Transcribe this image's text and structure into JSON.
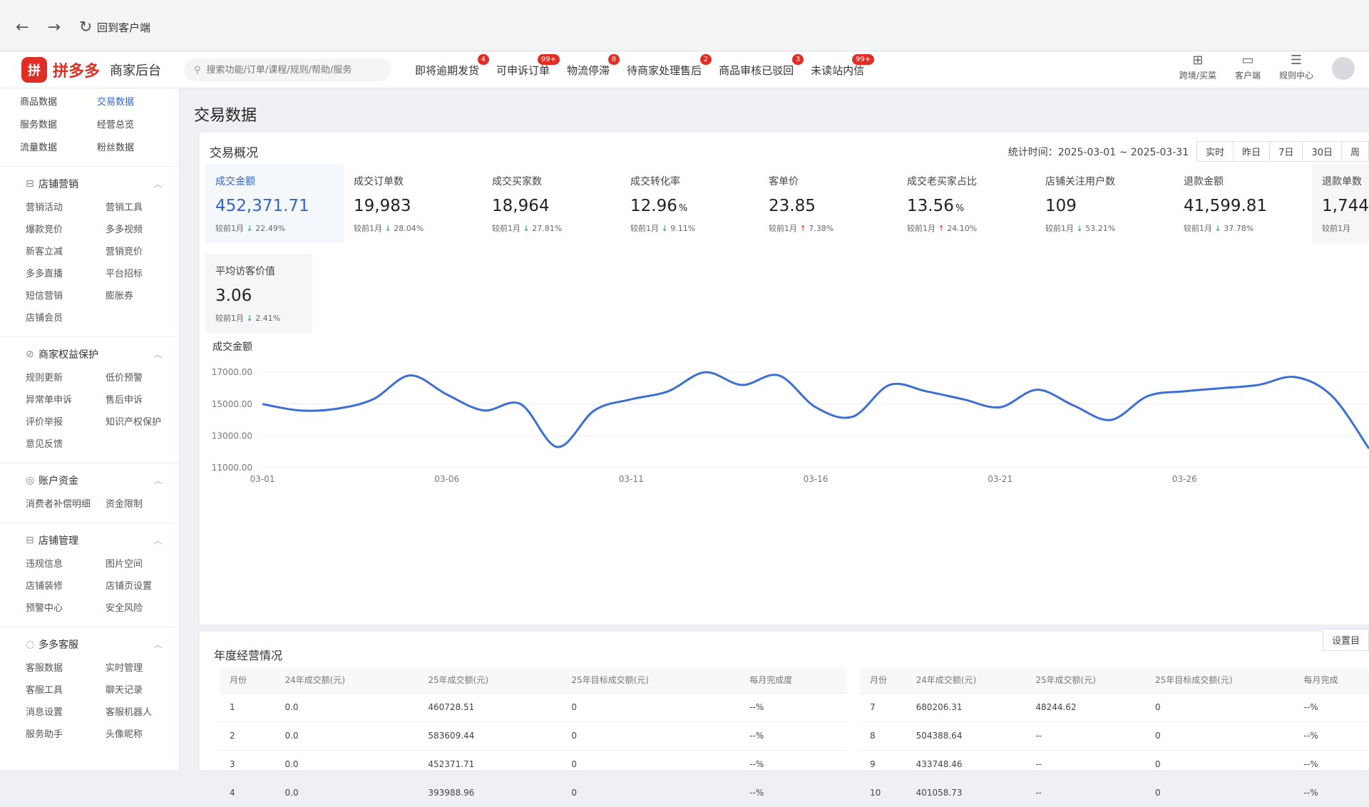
{
  "browser": {
    "back_link": "回到客户端"
  },
  "header": {
    "logo_mark": "拼",
    "logo_name": "拼多多",
    "logo_sub": "商家后台",
    "search_placeholder": "搜索功能/订单/课程/规则/帮助/服务",
    "links": [
      {
        "label": "即将逾期发货",
        "badge": "4"
      },
      {
        "label": "可申诉订单",
        "badge": "99+"
      },
      {
        "label": "物流停滞",
        "badge": "8"
      },
      {
        "label": "待商家处理售后",
        "badge": "2"
      },
      {
        "label": "商品审核已驳回",
        "badge": "3"
      },
      {
        "label": "未读站内信",
        "badge": "99+"
      }
    ],
    "icons": [
      {
        "label": "跨境/买菜",
        "icon": "globe-icon"
      },
      {
        "label": "客户端",
        "icon": "monitor-icon"
      },
      {
        "label": "规则中心",
        "icon": "rules-icon"
      }
    ]
  },
  "sidebar": {
    "quick": [
      "商品数据",
      "交易数据",
      "服务数据",
      "经营总览",
      "流量数据",
      "粉丝数据"
    ],
    "quick_active": "交易数据",
    "sections": [
      {
        "title": "店铺营销",
        "icon": "shop-icon",
        "items": [
          "营销活动",
          "营销工具",
          "爆款竞价",
          "多多视频",
          "新客立减",
          "营销竞价",
          "多多直播",
          "平台招标",
          "短信营销",
          "膨胀券",
          "店铺会员"
        ]
      },
      {
        "title": "商家权益保护",
        "icon": "shield-icon",
        "items": [
          "规则更新",
          "低价预警",
          "异常单申诉",
          "售后申诉",
          "评价举报",
          "知识产权保护",
          "意见反馈"
        ]
      },
      {
        "title": "账户资金",
        "icon": "wallet-icon",
        "items": [
          "消费者补偿明细",
          "资金限制"
        ]
      },
      {
        "title": "店铺管理",
        "icon": "store-icon",
        "items": [
          "违规信息",
          "图片空间",
          "店铺装修",
          "店铺页设置",
          "预警中心",
          "安全风险"
        ]
      },
      {
        "title": "多多客服",
        "icon": "headset-icon",
        "items": [
          "客服数据",
          "实时管理",
          "客服工具",
          "聊天记录",
          "消息设置",
          "客服机器人",
          "服务助手",
          "头像昵称"
        ]
      }
    ]
  },
  "main": {
    "page_title": "交易数据",
    "overview_title": "交易概况",
    "stat_time": "统计时间：2025-03-01 ~ 2025-03-31",
    "period_tabs": [
      "实时",
      "昨日",
      "7日",
      "30日",
      "周"
    ],
    "metrics": [
      {
        "label": "成交金额",
        "value": "452,371.71",
        "unit": "",
        "cmp_label": "较前1月",
        "dir": "down",
        "cmp": "22.49%"
      },
      {
        "label": "成交订单数",
        "value": "19,983",
        "unit": "",
        "cmp_label": "较前1月",
        "dir": "down",
        "cmp": "28.04%"
      },
      {
        "label": "成交买家数",
        "value": "18,964",
        "unit": "",
        "cmp_label": "较前1月",
        "dir": "down",
        "cmp": "27.81%"
      },
      {
        "label": "成交转化率",
        "value": "12.96",
        "unit": "%",
        "cmp_label": "较前1月",
        "dir": "down",
        "cmp": "9.11%"
      },
      {
        "label": "客单价",
        "value": "23.85",
        "unit": "",
        "cmp_label": "较前1月",
        "dir": "up",
        "cmp": "7.38%"
      },
      {
        "label": "成交老买家占比",
        "value": "13.56",
        "unit": "%",
        "cmp_label": "较前1月",
        "dir": "up",
        "cmp": "24.10%"
      },
      {
        "label": "店铺关注用户数",
        "value": "109",
        "unit": "",
        "cmp_label": "较前1月",
        "dir": "down",
        "cmp": "53.21%"
      },
      {
        "label": "退款金额",
        "value": "41,599.81",
        "unit": "",
        "cmp_label": "较前1月",
        "dir": "down",
        "cmp": "37.78%"
      },
      {
        "label": "退款单数",
        "value": "1,744",
        "unit": "",
        "cmp_label": "较前1月",
        "dir": "",
        "cmp": ""
      }
    ],
    "metric_extra": {
      "label": "平均访客价值",
      "value": "3.06",
      "cmp_label": "较前1月",
      "dir": "down",
      "cmp": "2.41%"
    },
    "annual_title": "年度经营情况",
    "set_button": "设置目",
    "table_headers": [
      "月份",
      "24年成交额(元)",
      "25年成交额(元)",
      "25年目标成交额(元)",
      "每月完成度"
    ],
    "table_headers_right": [
      "月份",
      "24年成交额(元)",
      "25年成交额(元)",
      "25年目标成交额(元)",
      "每月完成"
    ],
    "rows_left": [
      [
        "1",
        "0.0",
        "460728.51",
        "0",
        "--%"
      ],
      [
        "2",
        "0.0",
        "583609.44",
        "0",
        "--%"
      ],
      [
        "3",
        "0.0",
        "452371.71",
        "0",
        "--%"
      ],
      [
        "4",
        "0.0",
        "393988.96",
        "0",
        "--%"
      ]
    ],
    "rows_right": [
      [
        "7",
        "680206.31",
        "48244.62",
        "0",
        "--%"
      ],
      [
        "8",
        "504388.64",
        "--",
        "0",
        "--%"
      ],
      [
        "9",
        "433748.46",
        "--",
        "0",
        "--%"
      ],
      [
        "10",
        "401058.73",
        "--",
        "0",
        "--%"
      ]
    ]
  },
  "chart_data": {
    "type": "line",
    "title": "成交金额",
    "x": [
      "03-01",
      "03-02",
      "03-03",
      "03-04",
      "03-05",
      "03-06",
      "03-07",
      "03-08",
      "03-09",
      "03-10",
      "03-11",
      "03-12",
      "03-13",
      "03-14",
      "03-15",
      "03-16",
      "03-17",
      "03-18",
      "03-19",
      "03-20",
      "03-21",
      "03-22",
      "03-23",
      "03-24",
      "03-25",
      "03-26",
      "03-27",
      "03-28",
      "03-29",
      "03-30",
      "03-31"
    ],
    "series": [
      {
        "values": [
          15000,
          14600,
          14700,
          15300,
          16800,
          15600,
          14600,
          15000,
          12300,
          14600,
          15300,
          15800,
          17000,
          16200,
          16800,
          14800,
          14200,
          16200,
          15800,
          15300,
          14800,
          15900,
          14900,
          14000,
          15500,
          15800,
          16000,
          16200,
          16700,
          15500,
          12200
        ]
      }
    ],
    "xticks": [
      "03-01",
      "03-06",
      "03-11",
      "03-16",
      "03-21",
      "03-26"
    ],
    "yticks": [
      11000,
      13000,
      15000,
      17000
    ],
    "ytick_labels": [
      "11000.00",
      "13000.00",
      "15000.00",
      "17000.00"
    ],
    "ylim": [
      11000,
      17500
    ],
    "color": "#3b6fd4",
    "grid": true
  }
}
